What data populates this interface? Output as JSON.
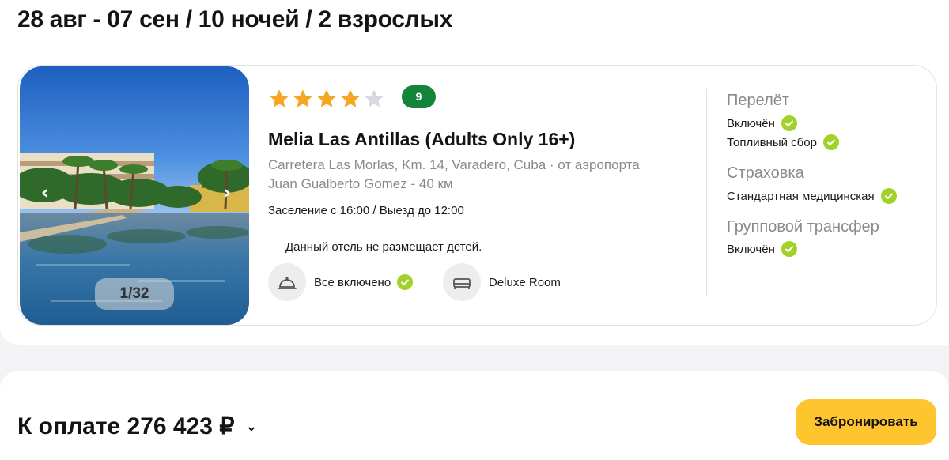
{
  "trip": {
    "summary": "28 авг - 07 сен / 10 ночей / 2 взрослых"
  },
  "hotel": {
    "stars": 4,
    "max_stars": 5,
    "rating": "9",
    "name": "Melia Las Antillas (Adults Only 16+)",
    "address_line1": "Carretera Las Morlas, Km. 14, Varadero, Cuba · от аэропорта",
    "address_line2": "Juan Gualberto Gomez - 40 км",
    "checkin": "Заселение с 16:00 / Выезд до 12:00",
    "children_note": "Данный отель не размещает детей.",
    "gallery": {
      "counter": "1/32",
      "prev_icon": "chevron-left-icon",
      "next_icon": "chevron-right-icon"
    },
    "features": [
      {
        "label": "Все включено",
        "icon": "cloche-icon",
        "included": true
      },
      {
        "label": "Deluxe Room",
        "icon": "bed-icon",
        "included": false
      }
    ]
  },
  "services": {
    "flight": {
      "title": "Перелёт",
      "items": [
        {
          "label": "Включён"
        },
        {
          "label": "Топливный сбор"
        }
      ]
    },
    "insurance": {
      "title": "Страховка",
      "items": [
        {
          "label": "Стандартная медицинская"
        }
      ]
    },
    "transfer": {
      "title": "Групповой трансфер",
      "items": [
        {
          "label": "Включён"
        }
      ]
    }
  },
  "footer": {
    "total": "К оплате 276 423 ₽",
    "book_label": "Забронировать"
  },
  "colors": {
    "accent": "#ffc52e",
    "check": "#a2d12a",
    "rating": "#12853a",
    "star": "#f5a623",
    "star_empty": "#d7d9df"
  }
}
